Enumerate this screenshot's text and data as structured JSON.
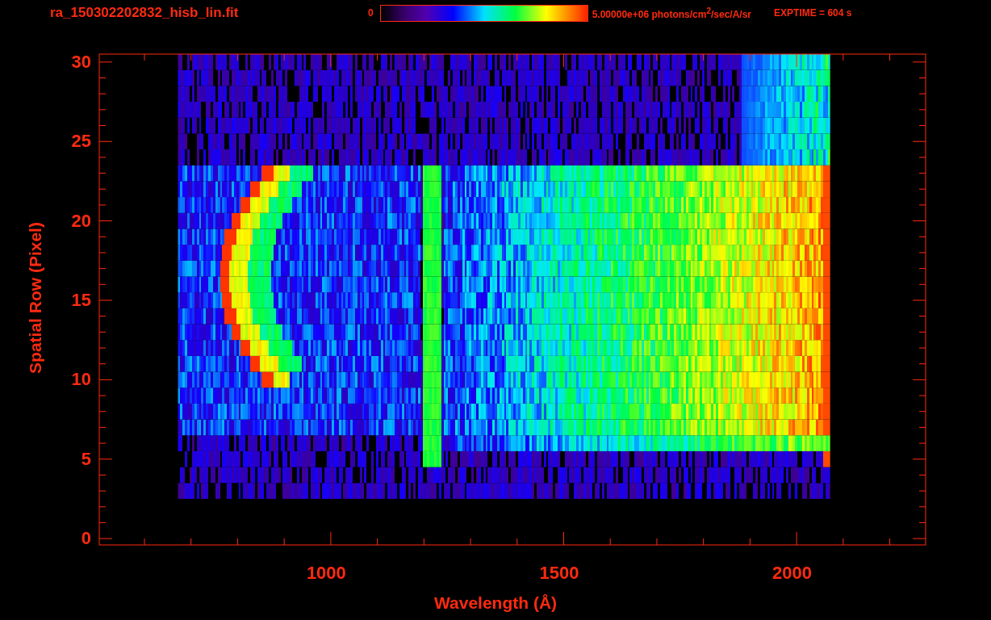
{
  "header": {
    "file_name": "ra_150302202832_hisb_lin.fit",
    "colorbar_min": "0",
    "colorbar_max": "5.00000e+06 photons/cm$^{2}$/sec/A/sr",
    "exptime": "EXPTIME = 604 s"
  },
  "plot": {
    "xlabel": "Wavelength (Å)",
    "ylabel": "Spatial Row (Pixel)",
    "xticks": [
      "1000",
      "1500",
      "2000"
    ],
    "yticks": [
      "30",
      "25",
      "20",
      "15",
      "10",
      "5",
      "0"
    ]
  }
}
